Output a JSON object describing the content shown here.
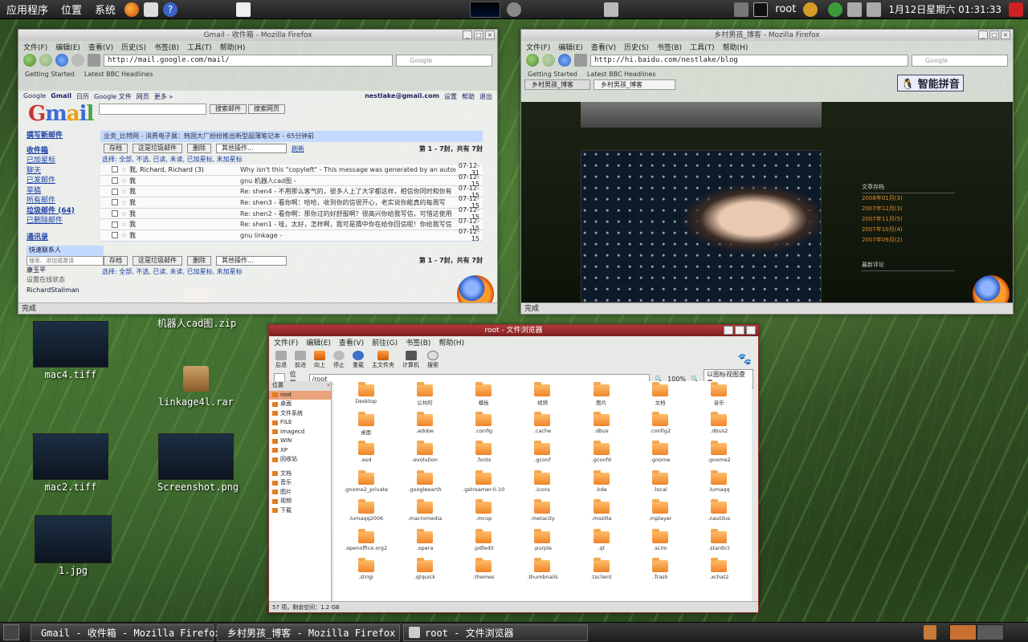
{
  "top_panel": {
    "menus": [
      "应用程序",
      "位置",
      "系统"
    ],
    "user": "root",
    "clock": "1月12日星期六 01:31:33"
  },
  "gmail_window": {
    "title": "Gmail - 收件箱 - Mozilla Firefox",
    "menu": [
      "文件(F)",
      "编辑(E)",
      "查看(V)",
      "历史(S)",
      "书签(B)",
      "工具(T)",
      "帮助(H)"
    ],
    "url": "http://mail.google.com/mail/",
    "search_placeholder": "Google",
    "bookmarks": [
      "Getting Started",
      "Latest BBC Headlines"
    ],
    "top_links": [
      "Google",
      "Gmail",
      "日历",
      "Google 文件",
      "网页",
      "更多 »"
    ],
    "account": "nestlake@gmail.com",
    "account_links": [
      "设置",
      "帮助",
      "退出"
    ],
    "search_mail_btn": "搜索邮件",
    "search_web_btn": "搜索网页",
    "compose": "撰写新邮件",
    "left_nav": [
      "收件箱",
      "已加星标",
      "聊天",
      "已发邮件",
      "草稿",
      "所有邮件",
      "垃圾邮件 (64)",
      "已删除邮件"
    ],
    "contacts": "通讯录",
    "quick_contacts": "快速联系人",
    "contact_search": "搜索、添加或邀请",
    "contact_1": "康玉平",
    "status_set": "设置在线状态",
    "contact_2": "RichardStallman",
    "list_header": "业务_比特网 - 消费电子展：韩国大厂纷纷推出新型超薄笔记本",
    "list_header_time": "- 65分钟前",
    "archive": "存档",
    "report_spam": "这是垃圾邮件",
    "delete": "删除",
    "more_actions": "其他操作...",
    "refresh": "刷新",
    "count": "第 1 - 7封，共有 7封",
    "select_line": "选择: 全部, 不选, 已读, 未读, 已加星标, 未加星标",
    "rows": [
      {
        "from": "我, Richard, Richard (3)",
        "subject": "Why isn't this \"copyleft\" - This message was generated by an automated",
        "date": "07-12-31"
      },
      {
        "from": "我",
        "subject": "gnu 机器人cad图 -",
        "date": "07-12-15"
      },
      {
        "from": "我",
        "subject": "Re: shen4 - 不用那么客气的，很多人上了大学都这样，相信你同时和你有",
        "date": "07-12-15"
      },
      {
        "from": "我",
        "subject": "Re: shen3 - 看你啊：哈哈，收到你的信很开心，老实说你能真的每周写",
        "date": "07-12-15"
      },
      {
        "from": "我",
        "subject": "Re: shen2 - 看你啊：那你过的好舒服啊？很高兴你给我写信，可惜这使用",
        "date": "07-12-15"
      },
      {
        "from": "我",
        "subject": "Re: shen1 - 哇，太好，怎样啊，我可是猜中你在给你回信呢！你给我写信",
        "date": "07-12-15"
      },
      {
        "from": "我",
        "subject": "gnu linkage -",
        "date": "07-12-15"
      }
    ],
    "status": "完成"
  },
  "blog_window": {
    "title": "乡村男孩_博客 - Mozilla Firefox",
    "url": "http://hi.baidu.com/nestlake/blog",
    "tabs": [
      "乡村男孩_博客",
      "乡村男孩_博客"
    ],
    "ime": "智能拼音",
    "status": "完成",
    "sidebar_title": "文章存档",
    "sidebar_items": [
      "2008年01月(3)",
      "2007年12月(3)",
      "2007年11月(5)",
      "2007年10月(4)",
      "2007年09月(2)"
    ],
    "recent_title": "最新评论"
  },
  "fm_window": {
    "title": "root - 文件浏览器",
    "menu": [
      "文件(F)",
      "编辑(E)",
      "查看(V)",
      "前往(G)",
      "书签(B)",
      "帮助(H)"
    ],
    "tools": [
      "后退",
      "前进",
      "向上",
      "停止",
      "重载",
      "主文件夹",
      "计算机",
      "搜索"
    ],
    "location_label": "位置:",
    "location": "/root",
    "zoom": "100%",
    "view_mode": "以图标视图查看",
    "side_header": "位置",
    "side_items": [
      "root",
      "桌面",
      "文件系统",
      "FILE",
      "Imagecd",
      "WIN",
      "XP",
      "回收站",
      "文档",
      "音乐",
      "图片",
      "视频",
      "下载"
    ],
    "folders": [
      "Desktop",
      "公共的",
      "模板",
      "视频",
      "图片",
      "文档",
      "音乐",
      "桌面",
      ".adobe",
      ".config",
      ".cache",
      ".dbus",
      ".config2",
      ".dbus2",
      ".esd",
      ".evolution",
      ".fonts",
      ".gconf",
      ".gconfd",
      ".gnome",
      ".gnome2",
      ".gnome2_private",
      ".googleearth",
      ".gstreamer-0.10",
      ".icons",
      ".kde",
      ".local",
      ".lumaqq",
      ".lumaqq2006",
      ".macromedia",
      ".mcop",
      ".metacity",
      ".mozilla",
      ".mplayer",
      ".nautilus",
      ".openoffice.org2",
      ".opera",
      ".pdfedit",
      ".purple",
      ".qt",
      ".scim",
      ".stardict",
      ".strigi",
      ".qtquick",
      ".themes",
      ".thumbnails",
      ".tsclient",
      ".Trash",
      ".xchat2"
    ],
    "status": "57 项，剩余空间：1.2 GB"
  },
  "desktop_icons": [
    "mac4.tiff",
    "mac2.tiff",
    "1.jpg",
    "机器人cad图.zip",
    "linkage4l.rar",
    "Screenshot.png"
  ],
  "taskbar": [
    "Gmail - 收件箱 - Mozilla Firefox",
    "乡村男孩_博客 - Mozilla Firefox",
    "root - 文件浏览器"
  ]
}
